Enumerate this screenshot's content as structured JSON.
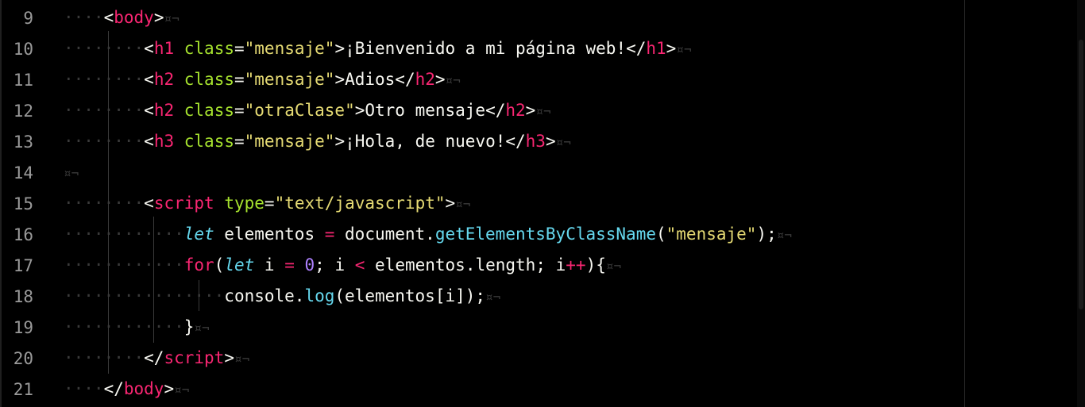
{
  "editor": {
    "lines": [
      {
        "num": "9",
        "dots": "····",
        "html": "&lt;<span class='tag'>body</span>&gt;"
      },
      {
        "num": "10",
        "dots": "········",
        "html": "&lt;<span class='tag'>h1</span> <span class='attr'>class</span>=<span class='str'>\"mensaje\"</span>&gt;¡Bienvenido a mi página web!&lt;/<span class='tag'>h1</span>&gt;"
      },
      {
        "num": "11",
        "dots": "········",
        "html": "&lt;<span class='tag'>h2</span> <span class='attr'>class</span>=<span class='str'>\"mensaje\"</span>&gt;Adios&lt;/<span class='tag'>h2</span>&gt;"
      },
      {
        "num": "12",
        "dots": "········",
        "html": "&lt;<span class='tag'>h2</span> <span class='attr'>class</span>=<span class='str'>\"otraClase\"</span>&gt;Otro mensaje&lt;/<span class='tag'>h2</span>&gt;"
      },
      {
        "num": "13",
        "dots": "········",
        "html": "&lt;<span class='tag'>h3</span> <span class='attr'>class</span>=<span class='str'>\"mensaje\"</span>&gt;¡Hola, de nuevo!&lt;/<span class='tag'>h3</span>&gt;"
      },
      {
        "num": "14",
        "dots": "",
        "html": ""
      },
      {
        "num": "15",
        "dots": "········",
        "html": "&lt;<span class='tag'>script</span> <span class='attr'>type</span>=<span class='str'>\"text/javascript\"</span>&gt;"
      },
      {
        "num": "16",
        "dots": "············",
        "html": "<span class='kw'>let</span> elementos <span class='op'>=</span> document.<span class='fn'>getElementsByClassName</span>(<span class='str'>\"mensaje\"</span>);"
      },
      {
        "num": "17",
        "dots": "············",
        "html": "<span class='ctl'>for</span>(<span class='kw'>let</span> i <span class='op'>=</span> <span class='num'>0</span>; i <span class='op'>&lt;</span> elementos.length; i<span class='op'>++</span>){"
      },
      {
        "num": "18",
        "dots": "················",
        "html": "console.<span class='fn'>log</span>(elementos[i]);"
      },
      {
        "num": "19",
        "dots": "············",
        "html": "}"
      },
      {
        "num": "20",
        "dots": "········",
        "html": "&lt;/<span class='tag'>script</span>&gt;"
      },
      {
        "num": "21",
        "dots": "····",
        "html": "&lt;/<span class='tag'>body</span>&gt;"
      }
    ],
    "eol_marker": "¤¬"
  }
}
